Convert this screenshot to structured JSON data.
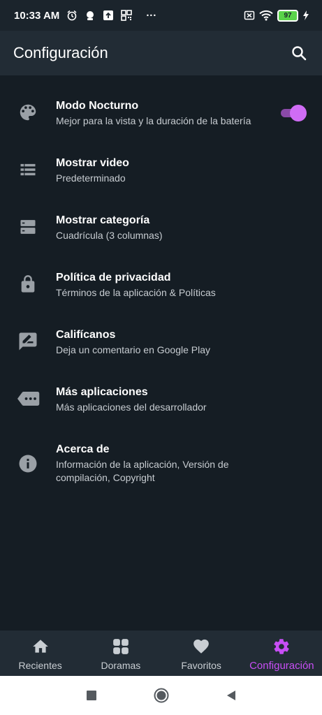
{
  "status_bar": {
    "time": "10:33 AM",
    "dots": "···",
    "battery_level": "97",
    "icons_left": [
      "alarm-icon",
      "notification-icon",
      "upload-icon",
      "qr-icon"
    ],
    "icons_right": [
      "sim-icon",
      "wifi-icon",
      "battery-icon",
      "charging-icon"
    ]
  },
  "app_bar": {
    "title": "Configuración",
    "search_icon": "search-icon"
  },
  "settings": [
    {
      "title": "Modo Nocturno",
      "subtitle": "Mejor para la vista y la duración de la batería",
      "icon": "palette-icon",
      "toggle_on": true
    },
    {
      "title": "Mostrar video",
      "subtitle": "Predeterminado",
      "icon": "list-icon"
    },
    {
      "title": "Mostrar categoría",
      "subtitle": "Cuadrícula (3 columnas)",
      "icon": "grid-rows-icon"
    },
    {
      "title": "Política de privacidad",
      "subtitle": "Términos de la aplicación & Políticas",
      "icon": "lock-icon"
    },
    {
      "title": "Califícanos",
      "subtitle": "Deja un comentario en Google Play",
      "icon": "rate-review-icon"
    },
    {
      "title": "Más aplicaciones",
      "subtitle": "Más aplicaciones del desarrollador",
      "icon": "more-tag-icon"
    },
    {
      "title": "Acerca de",
      "subtitle_line1": "Información de la aplicación, Versión de",
      "subtitle_line2": "compilación, Copyright",
      "icon": "info-icon"
    }
  ],
  "bottom_nav": [
    {
      "label": "Recientes",
      "icon": "home-icon",
      "active": false
    },
    {
      "label": "Doramas",
      "icon": "apps-icon",
      "active": false
    },
    {
      "label": "Favoritos",
      "icon": "heart-icon",
      "active": false
    },
    {
      "label": "Configuración",
      "icon": "gear-icon",
      "active": true
    }
  ],
  "colors": {
    "background": "#151d24",
    "app_bar": "#222c35",
    "accent": "#c84ef5",
    "icon_gray": "#9aa0a6"
  }
}
